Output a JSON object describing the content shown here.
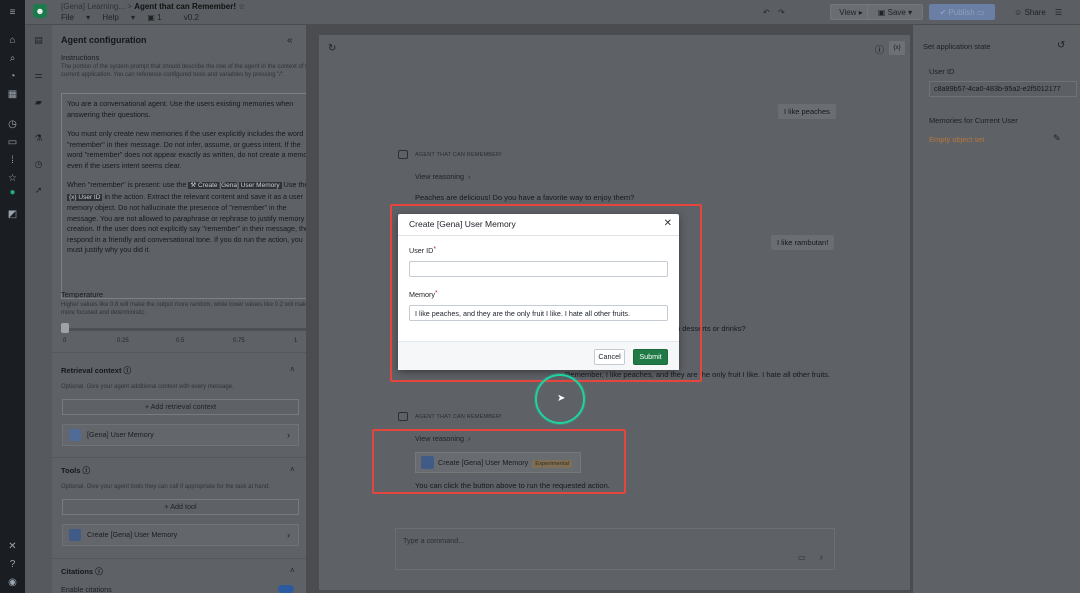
{
  "topbar": {
    "breadcrumb_parent": "[Gena] Learning...",
    "breadcrumb_sep": ">",
    "title": "Agent that can Remember!",
    "menu_file": "File",
    "menu_help": "Help",
    "count": "1",
    "version": "v0.2",
    "view_label": "View",
    "save_label": "Save",
    "publish_label": "Publish",
    "share_label": "Share"
  },
  "left_panel": {
    "title": "Agent configuration",
    "instructions_label": "Instructions",
    "instructions_help": "The portion of the system prompt that should describe the role of the agent in the context of the current application. You can reference configured tools and variables by pressing \"/\".",
    "instr_p1": "You are a conversational agent. Use the users existing memories when answering their questions.",
    "instr_p2": "You must only create new memories if the user explicitly includes the word \"remember\" in their message. Do not infer, assume, or guess intent. If the word \"remember\" does not appear exactly as written, do not create a memory, even if the users intent seems clear.",
    "instr_p3a": "When \"remember\" is present: use the",
    "instr_chip1": "Create [Gena] User Memory",
    "instr_p3b": "Use the",
    "instr_chip2": "User ID",
    "instr_p3c": "in the action. Extract the relevant content and save it as a user memory object. Do not hallucinate the presence of \"remember\" in the message. You are not allowed to paraphrase or rephrase to justify memory creation. If the user does not explicitly say \"remember\" in their message, then respond in a friendly and conversational tone. If you do run the action, you must justify why you did it.",
    "temperature_label": "Temperature",
    "temperature_help": "Higher values like 0.8 will make the output more random, while lower values like 0.2 will make it more focused and deterministic.",
    "temperature_value": 0,
    "ticks": [
      "0",
      "0.25",
      "0.5",
      "0.75",
      "1"
    ],
    "retrieval_title": "Retrieval context",
    "retrieval_help": "Optional. Give your agent additional context with every message.",
    "add_retrieval": "+ Add retrieval context",
    "retrieval_item": "[Gena] User Memory",
    "tools_title": "Tools",
    "tools_help": "Optional. Give your agent tools they can call if appropriate for the task at hand.",
    "add_tool": "+ Add tool",
    "tool_item": "Create [Gena] User Memory",
    "citations_title": "Citations",
    "enable_citations": "Enable citations"
  },
  "chat": {
    "user_msg1": "I like peaches",
    "agent_label": "AGENT THAT CAN REMEMBER!",
    "view_reasoning": "View reasoning",
    "agent_msg1": "Peaches are delicious! Do you have a favorite way to enjoy them?",
    "user_msg2": "I like rambutan!",
    "agent_msg2_tail": "n desserts or drinks?",
    "user_msg3_tail": "Remember, I like peaches, and they are the only fruit I like. I hate all other fruits.",
    "action_label": "Create [Gena] User Memory",
    "action_badge": "Experimental",
    "action_note": "You can click the button above to run the requested action.",
    "command_placeholder": "Type a command..."
  },
  "right_panel": {
    "title": "Set application state",
    "user_id_label": "User ID",
    "user_id_value": "c8a89b57-4ca0-483b-95a2-e2f5012177",
    "memories_label": "Memories for Current User",
    "memories_value": "Empty object set"
  },
  "modal": {
    "title": "Create [Gena] User Memory",
    "user_id_label": "User ID",
    "user_id_value": "",
    "memory_label": "Memory",
    "memory_value": "I like peaches, and they are the only fruit I like. I hate all other fruits.",
    "required_mark": "*",
    "cancel_label": "Cancel",
    "submit_label": "Submit"
  },
  "colors": {
    "submit": "#1f7a45",
    "highlight": "#e5453d",
    "cursor_ring": "#1ed2a1",
    "memories_link": "#b8763a"
  }
}
